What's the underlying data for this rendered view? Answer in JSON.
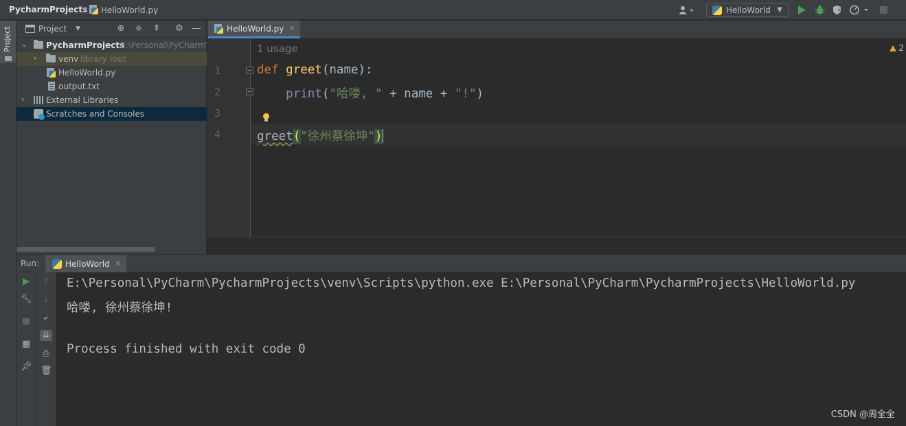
{
  "breadcrumb": {
    "project": "PycharmProjects",
    "file": "HelloWorld.py"
  },
  "toolbar": {
    "run_config": "HelloWorld"
  },
  "left_strip": {
    "project_tab": "Project"
  },
  "project_panel": {
    "title": "Project",
    "tree": [
      {
        "label": "PycharmProjects",
        "hint": "E:\\Personal\\PyCharm\\"
      },
      {
        "label": "venv",
        "hint": "library root"
      },
      {
        "label": "HelloWorld.py"
      },
      {
        "label": "output.txt"
      },
      {
        "label": "External Libraries"
      },
      {
        "label": "Scratches and Consoles"
      }
    ]
  },
  "editor": {
    "tab": "HelloWorld.py",
    "usage_hint": "1 usage",
    "warnings": "2",
    "line_numbers": [
      "1",
      "2",
      "3",
      "4"
    ],
    "code": {
      "l1_kw": "def",
      "l1_fn": "greet",
      "l1_rest": "(name):",
      "l2_indent": "    ",
      "l2_fn": "print",
      "l2_open": "(",
      "l2_str1": "\"哈喽, \"",
      "l2_mid": " + name + ",
      "l2_str2": "\"!\"",
      "l2_close": ")",
      "l4_call": "greet",
      "l4_open": "(",
      "l4_str": "\"徐州蔡徐坤\"",
      "l4_close": ")"
    }
  },
  "run_panel": {
    "label": "Run:",
    "tab": "HelloWorld",
    "console": [
      "E:\\Personal\\PyCharm\\PycharmProjects\\venv\\Scripts\\python.exe E:\\Personal\\PyCharm\\PycharmProjects\\HelloWorld.py",
      "哈喽, 徐州蔡徐坤!",
      "",
      "Process finished with exit code 0"
    ]
  },
  "watermark": "CSDN @周全全"
}
